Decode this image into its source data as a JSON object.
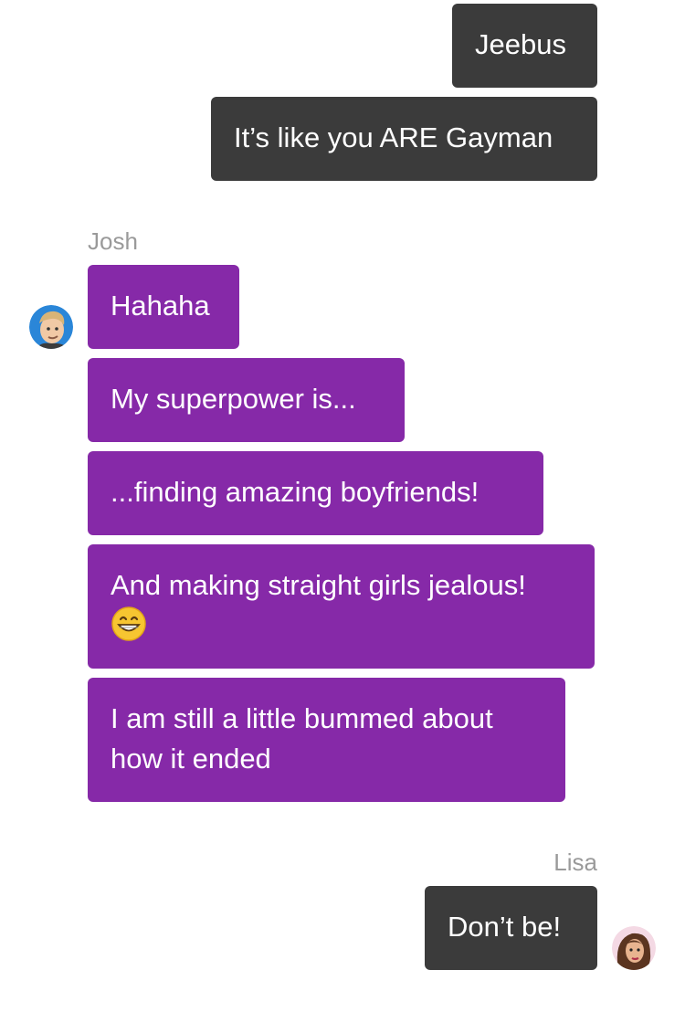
{
  "thread": {
    "outgoing_1": "Jeebus",
    "outgoing_2": "It’s like you ARE Gayman",
    "josh_name": "Josh",
    "josh_msg_1": "Hahaha",
    "josh_msg_2": "My superpower is...",
    "josh_msg_3": "...finding amazing boyfriends!",
    "josh_msg_4": "And making straight girls jealous!",
    "josh_msg_4_emoji": "grinning-face-emoji",
    "josh_msg_5": "I am still a little bummed about how it ended",
    "lisa_name": "Lisa",
    "lisa_msg_1": "Don’t be!"
  },
  "colors": {
    "outgoing_bubble": "#3b3b3b",
    "incoming_bubble": "#8629a8",
    "sender_name": "#9a9a9a",
    "background": "#ffffff"
  },
  "avatars": {
    "josh": "josh-avatar",
    "lisa": "lisa-avatar"
  }
}
